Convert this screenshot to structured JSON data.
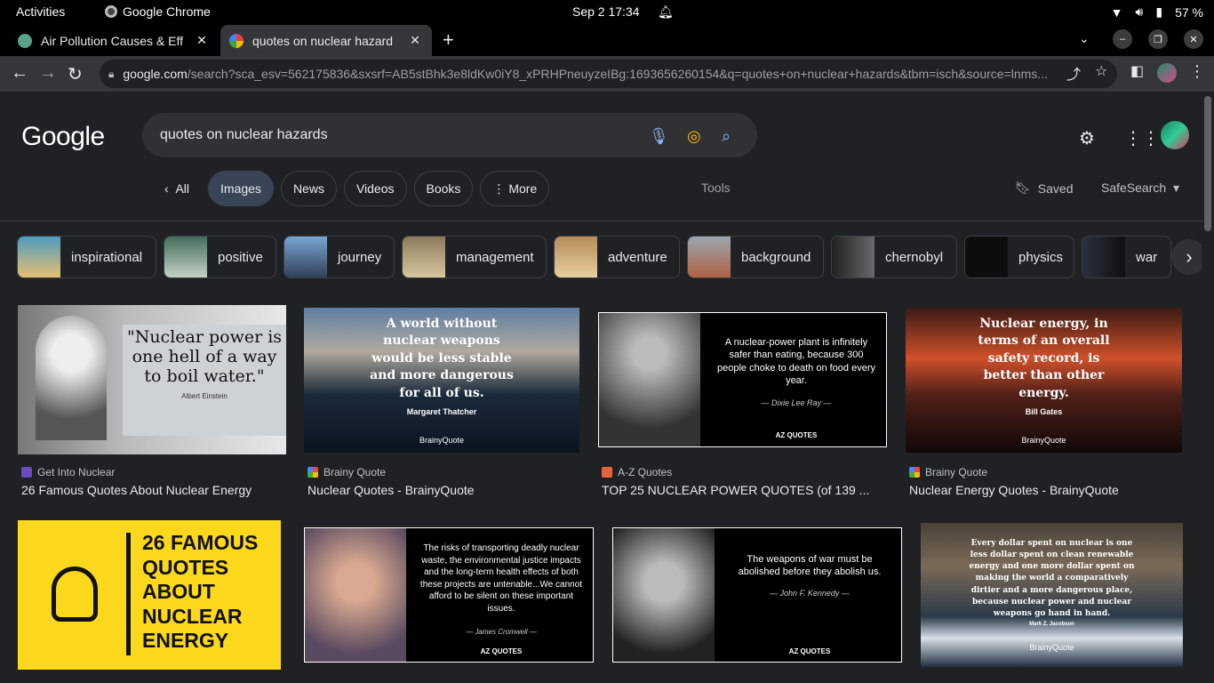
{
  "system_bar": {
    "activities": "Activities",
    "app": "Google Chrome",
    "clock": "Sep 2  17:34",
    "battery": "57 %"
  },
  "tabs": [
    {
      "title": "Air Pollution Causes & Eff",
      "active": false
    },
    {
      "title": "quotes on nuclear hazard",
      "active": true
    }
  ],
  "omnibox": {
    "host": "google.com",
    "path": "/search?sca_esv=562175836&sxsrf=AB5stBhk3e8ldKw0iY8_xPRHPneuyzeIBg:1693656260154&q=quotes+on+nuclear+hazards&tbm=isch&source=lnms..."
  },
  "search": {
    "logo": "Google",
    "query": "quotes on nuclear hazards"
  },
  "search_tabs": [
    "All",
    "Images",
    "News",
    "Videos",
    "Books",
    "More"
  ],
  "tools_label": "Tools",
  "saved_label": "Saved",
  "safesearch_label": "SafeSearch",
  "chips": [
    "inspirational",
    "positive",
    "journey",
    "management",
    "adventure",
    "background",
    "chernobyl",
    "physics",
    "war"
  ],
  "results": [
    {
      "source": "Get Into Nuclear",
      "title": "26 Famous Quotes About Nuclear Energy",
      "quote": "\"Nuclear power is one hell of a way to boil water.\"",
      "author": "Albert Einstein"
    },
    {
      "source": "Brainy Quote",
      "title": "Nuclear Quotes - BrainyQuote",
      "quote": "A world without nuclear weapons would be less stable and more dangerous for all of us.",
      "author": "Margaret Thatcher",
      "brand": "BrainyQuote"
    },
    {
      "source": "A-Z Quotes",
      "title": "TOP 25 NUCLEAR POWER QUOTES (of 139 ...",
      "quote": "A nuclear-power plant is infinitely safer than eating, because 300 people choke to death on food every year.",
      "author": "— Dixie Lee Ray —",
      "brand": "AZ QUOTES"
    },
    {
      "source": "Brainy Quote",
      "title": "Nuclear Energy Quotes - BrainyQuote",
      "quote": "Nuclear energy, in terms of an overall safety record, is better than other energy.",
      "author": "Bill Gates",
      "brand": "BrainyQuote"
    },
    {
      "quote": "26 FAMOUS QUOTES ABOUT NUCLEAR ENERGY"
    },
    {
      "quote": "The risks of transporting deadly nuclear waste, the environmental justice impacts and the long-term health effects of both these projects are untenable...We cannot afford to be silent on these important issues.",
      "author": "— James Cromwell —",
      "brand": "AZ QUOTES"
    },
    {
      "quote": "The weapons of war must be abolished before they abolish us.",
      "author": "— John F. Kennedy —",
      "brand": "AZ QUOTES"
    },
    {
      "quote": "Every dollar spent on nuclear is one less dollar spent on clean renewable energy and one more dollar spent on making the world a comparatively dirtier and a more dangerous place, because nuclear power and nuclear weapons go hand in hand.",
      "author": "Mark Z. Jacobson",
      "brand": "BrainyQuote"
    }
  ]
}
